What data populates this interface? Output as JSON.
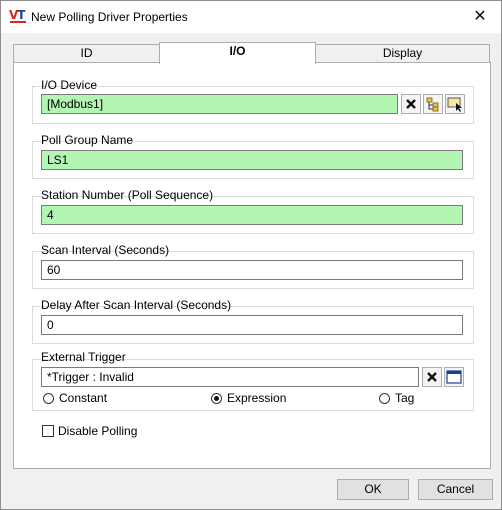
{
  "window": {
    "title": "New Polling Driver Properties",
    "close_glyph": "✕"
  },
  "tabs": [
    {
      "label": "ID"
    },
    {
      "label": "I/O",
      "active": true
    },
    {
      "label": "Display"
    }
  ],
  "io_device": {
    "label": "I/O Device",
    "value": "[Modbus1]"
  },
  "poll_group": {
    "label": "Poll Group Name",
    "value": "LS1"
  },
  "station_number": {
    "label": "Station Number (Poll Sequence)",
    "value": "4"
  },
  "scan_interval": {
    "label": "Scan Interval (Seconds)",
    "value": "60"
  },
  "delay_after_scan": {
    "label": "Delay After Scan Interval (Seconds)",
    "value": "0"
  },
  "external_trigger": {
    "label": "External Trigger",
    "value": "*Trigger : Invalid",
    "options": [
      "Constant",
      "Expression",
      "Tag"
    ],
    "selected": "Expression"
  },
  "disable_polling": {
    "label": "Disable Polling",
    "checked": false
  },
  "buttons": {
    "ok": "OK",
    "cancel": "Cancel"
  },
  "colors": {
    "valid_field": "#b3f5b3",
    "brand_red": "#d9261c"
  },
  "icons": [
    "vt-logo-icon",
    "close-icon",
    "clear-icon",
    "tree-browse-icon",
    "select-browse-icon",
    "window-icon"
  ]
}
